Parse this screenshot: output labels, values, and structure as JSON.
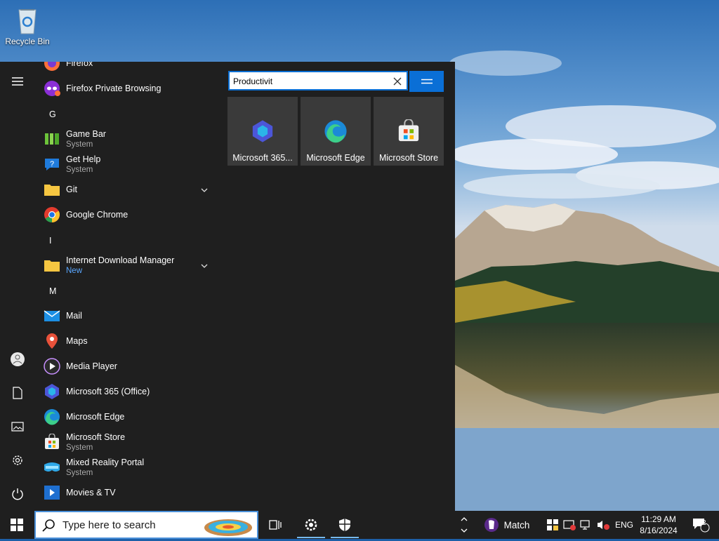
{
  "desktop": {
    "recycle_bin_label": "Recycle Bin"
  },
  "start_menu": {
    "apps": [
      {
        "name": "Firefox",
        "sub": ""
      },
      {
        "name": "Firefox Private Browsing",
        "sub": ""
      },
      {
        "letter": "G"
      },
      {
        "name": "Game Bar",
        "sub": "System"
      },
      {
        "name": "Get Help",
        "sub": "System"
      },
      {
        "name": "Git",
        "sub": "",
        "expandable": true
      },
      {
        "name": "Google Chrome",
        "sub": ""
      },
      {
        "letter": "I"
      },
      {
        "name": "Internet Download Manager",
        "sub": "New",
        "expandable": true
      },
      {
        "letter": "M"
      },
      {
        "name": "Mail",
        "sub": ""
      },
      {
        "name": "Maps",
        "sub": ""
      },
      {
        "name": "Media Player",
        "sub": ""
      },
      {
        "name": "Microsoft 365 (Office)",
        "sub": ""
      },
      {
        "name": "Microsoft Edge",
        "sub": ""
      },
      {
        "name": "Microsoft Store",
        "sub": "System"
      },
      {
        "name": "Mixed Reality Portal",
        "sub": "System"
      },
      {
        "name": "Movies & TV",
        "sub": ""
      }
    ],
    "search": {
      "value": "Productivit"
    },
    "results": [
      {
        "label": "Microsoft 365..."
      },
      {
        "label": "Microsoft Edge"
      },
      {
        "label": "Microsoft Store"
      }
    ]
  },
  "taskbar": {
    "search_placeholder": "Type here to search",
    "weather_label": "Match",
    "language": "ENG",
    "time": "11:29 AM",
    "date": "8/16/2024",
    "notification_count": "2"
  },
  "colors": {
    "accent": "#0a6fd6",
    "menu_bg": "#1f1f1f",
    "tile_bg": "#3a3a3a",
    "new_badge": "#5aa7ff"
  }
}
